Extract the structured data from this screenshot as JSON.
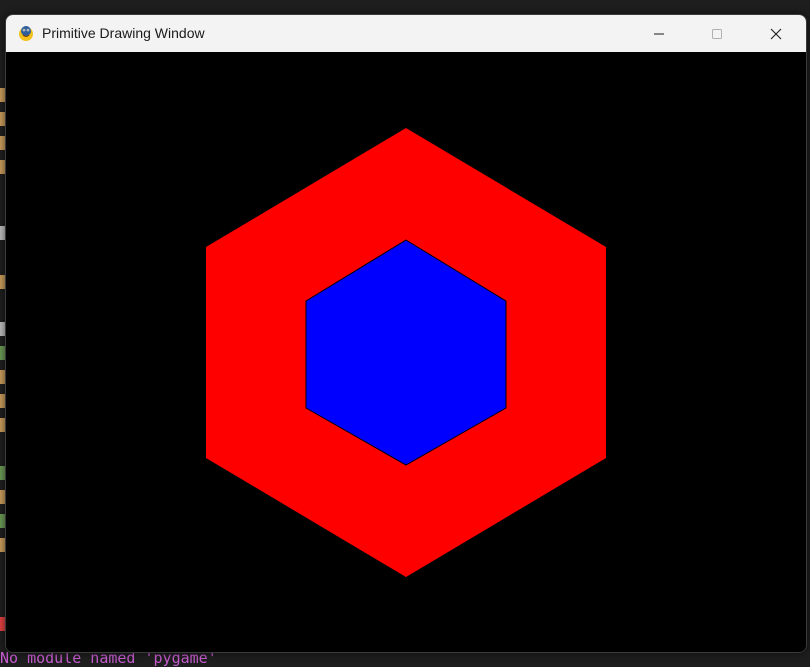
{
  "window": {
    "title": "Primitive Drawing Window",
    "app_icon": "pygame-snake-icon",
    "controls": {
      "minimize_icon": "minimize-icon",
      "maximize_icon": "maximize-icon",
      "close_icon": "close-icon"
    }
  },
  "canvas": {
    "background_color": "#000000",
    "outer_hexagon": {
      "fill": "#ff0000"
    },
    "inner_hexagon": {
      "fill": "#0000ff",
      "stroke": "#000000"
    }
  },
  "background_terminal": {
    "bottom_text": "No module named 'pygame'"
  }
}
